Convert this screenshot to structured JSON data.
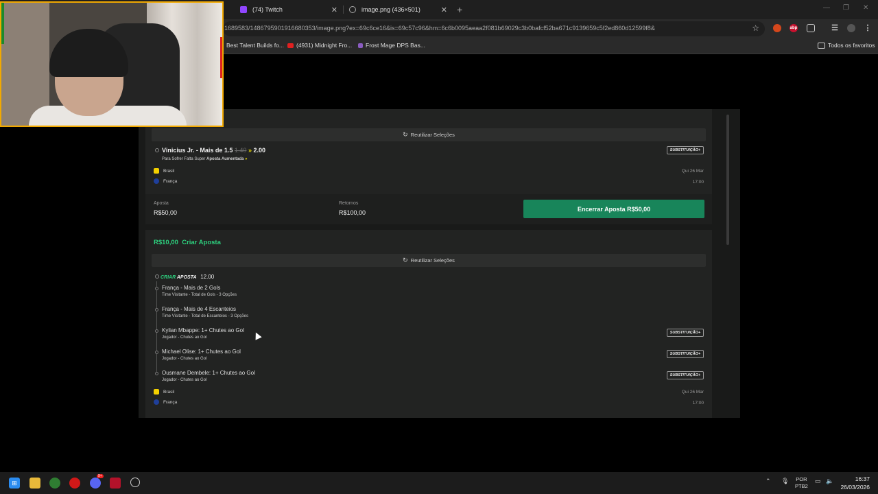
{
  "browser": {
    "tabs": [
      {
        "title": "(74) Twitch",
        "icon": "twitch-icon"
      },
      {
        "title": "image.png (436×501)",
        "icon": "globe-icon"
      }
    ],
    "new_tab": "+",
    "url": "1689583/1486795901916680353/image.png?ex=69c6ce16&is=69c57c96&hm=6c6b0095aeaa2f081b69029c3b0bafcf52ba671c9139659c5f2ed860d12599f8&",
    "extensions": [
      "abp"
    ],
    "bookmarks": [
      {
        "label": "Best Talent Builds fo...",
        "icon": "bookmark-icon"
      },
      {
        "label": "(4931) Midnight Fro...",
        "icon": "youtube-icon"
      },
      {
        "label": "Frost Mage DPS Bas...",
        "icon": "bookmark-icon"
      }
    ],
    "all_bookmarks": "Todos os favoritos"
  },
  "bet1": {
    "reuse_label": "Reutilizar Seleções",
    "selection": {
      "player": "Vinicius Jr. - Mais de 1.5",
      "old_odds": "1.40",
      "arrows": "»",
      "new_odds": "2.00",
      "market": "Para Sofrer Falta",
      "boost_prefix": "Super",
      "boost_label": "Aposta Aumentada",
      "boost_arrows": "»"
    },
    "substitution": "SUBSTITUIÇÃO+",
    "home_team": "Brasil",
    "away_team": "França",
    "date": "Qui 26 Mar",
    "time": "17:00",
    "stake_label": "Aposta",
    "stake_value": "R$50,00",
    "returns_label": "Retornos",
    "returns_value": "R$100,00",
    "cashout_label": "Encerrar Aposta",
    "cashout_value": "R$50,00"
  },
  "bet2": {
    "header_amount": "R$10,00",
    "header_title": "Criar Aposta",
    "reuse_label": "Reutilizar Seleções",
    "criar": "CRIAR",
    "aposta": "APOSTA",
    "odds": "12.00",
    "legs": [
      {
        "title": "França - Mais de 2 Gols",
        "sub": "Time Visitante - Total de Gols - 3 Opções",
        "subst": ""
      },
      {
        "title": "França - Mais de 4 Escanteios",
        "sub": "Time Visitante - Total de Escanteios - 3 Opções",
        "subst": ""
      },
      {
        "title": "Kylian Mbappe: 1+ Chutes ao Gol",
        "sub": "Jogador - Chutes ao Gol",
        "subst": "SUBSTITUIÇÃO+"
      },
      {
        "title": "Michael Olise: 1+ Chutes ao Gol",
        "sub": "Jogador - Chutes ao Gol",
        "subst": "SUBSTITUIÇÃO+"
      },
      {
        "title": "Ousmane Dembele: 1+ Chutes ao Gol",
        "sub": "Jogador - Chutes ao Gol",
        "subst": "SUBSTITUIÇÃO+"
      }
    ],
    "home_team": "Brasil",
    "away_team": "França",
    "date": "Qui 26 Mar",
    "time": "17:00"
  },
  "taskbar": {
    "lang": "POR",
    "layout": "PTB2",
    "time": "16:37",
    "date": "26/03/2026",
    "discord_badge": "9+"
  },
  "colors": {
    "accent_green": "#2dd07e",
    "cashout_green": "#18855a",
    "boost_yellow": "#e3d400",
    "cam_border": "#f2a900"
  }
}
